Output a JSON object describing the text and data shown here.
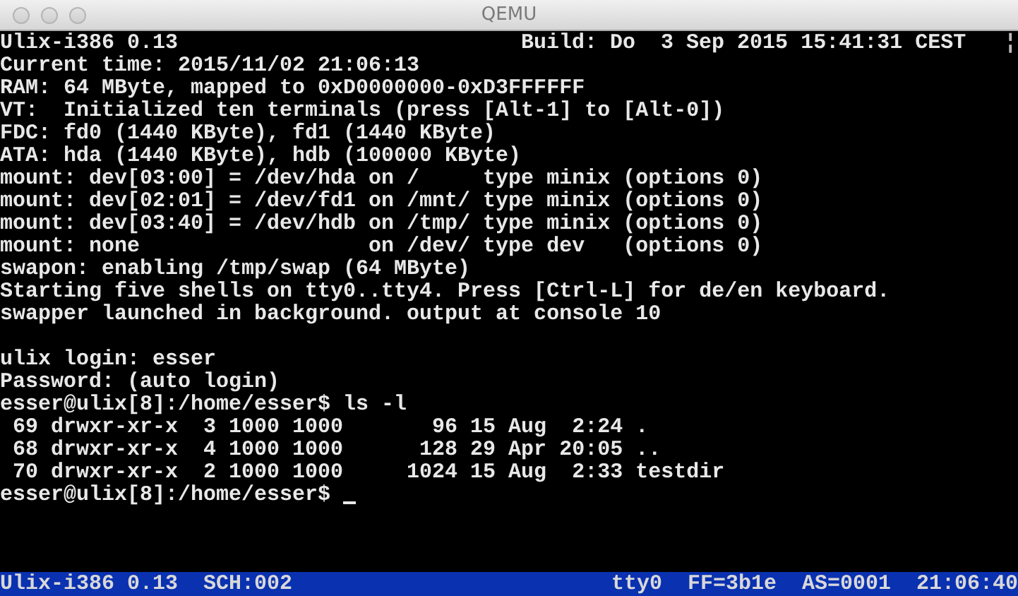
{
  "window": {
    "title": "QEMU",
    "focused": false
  },
  "console": {
    "header": {
      "left": "Ulix-i386 0.13",
      "right": "Build: Do  3 Sep 2015 15:41:31 CEST",
      "marker": "¦"
    },
    "boot_log": [
      {
        "text": "Current time: 2015/11/02 21:06:13"
      },
      {
        "text": "RAM: 64 MByte, mapped to 0xD0000000-0xD3FFFFFF"
      },
      {
        "text": "VT:  Initialized ten terminals (press [Alt-1] to [Alt-0])"
      },
      {
        "text": "FDC: fd0 (1440 KByte), fd1 (1440 KByte)"
      },
      {
        "text": "ATA: hda (1440 KByte), hdb (100000 KByte)"
      },
      {
        "text": "mount: dev[03:00] = /dev/hda on /     type minix (options 0)"
      },
      {
        "text": "mount: dev[02:01] = /dev/fd1 on /mnt/ type minix (options 0)"
      },
      {
        "text": "mount: dev[03:40] = /dev/hdb on /tmp/ type minix (options 0)"
      },
      {
        "text": "mount: none                  on /dev/ type dev   (options 0)"
      },
      {
        "text": "swapon: enabling /tmp/swap (64 MByte)"
      },
      {
        "text": "Starting five shells on tty0..tty4. Press [Ctrl-L] for de/en keyboard."
      },
      {
        "text": "swapper launched in background. output at console 10"
      }
    ],
    "session": [
      {
        "text": "ulix login: esser"
      },
      {
        "text": "Password: (auto login)"
      },
      {
        "text": "esser@ulix[8]:/home/esser$ ls -l"
      },
      {
        "text": " 69 drwxr-xr-x  3 1000 1000       96 15 Aug  2:24 ."
      },
      {
        "text": " 68 drwxr-xr-x  4 1000 1000      128 29 Apr 20:05 .."
      },
      {
        "text": " 70 drwxr-xr-x  2 1000 1000     1024 15 Aug  2:33 testdir"
      },
      {
        "text": "esser@ulix[8]:/home/esser$ ",
        "cursor": true
      }
    ]
  },
  "status_bar": {
    "left": [
      "Ulix-i386 0.13",
      "SCH:002"
    ],
    "right": [
      "tty0",
      "FF=3b1e",
      "AS=0001",
      "21:06:40"
    ]
  }
}
